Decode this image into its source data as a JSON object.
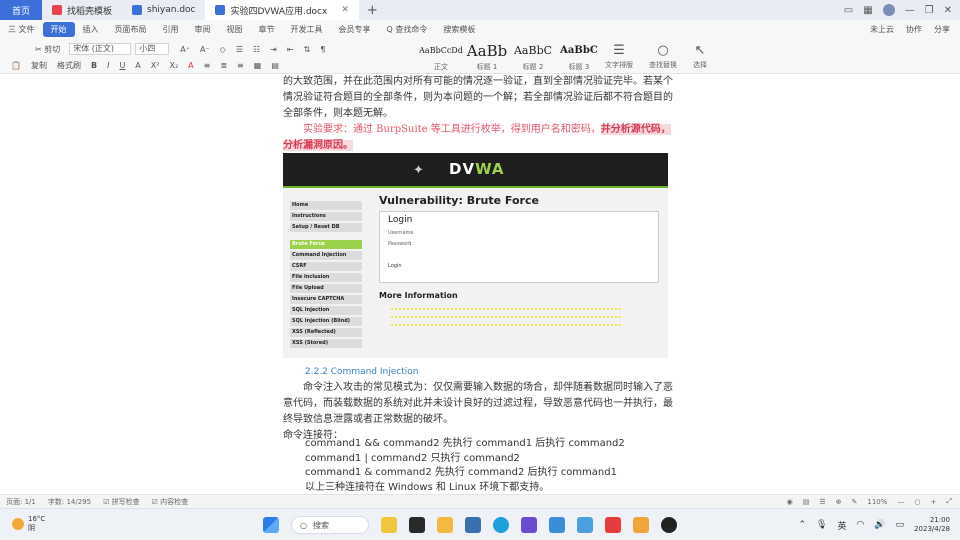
{
  "titlebar": {
    "tabs": [
      {
        "label": "首页",
        "color": "#3c6fd8"
      },
      {
        "label": "找稻壳模板",
        "color": "#e8424f"
      },
      {
        "label": "shiyan.doc",
        "color": "#3c6fd8"
      },
      {
        "label": "实验四DVWA应用.docx",
        "color": "#3c6fd8"
      }
    ],
    "plus": "+"
  },
  "menubar": {
    "items": [
      "三 文件",
      "开始",
      "插入",
      "页面布局",
      "引用",
      "审阅",
      "视图",
      "章节",
      "开发工具",
      "会员专享",
      "Q 查找命令",
      "搜索模板"
    ],
    "right": [
      "未上云",
      "协作",
      "分享"
    ]
  },
  "ribbon": {
    "row1": [
      "剪切",
      "宋体 (正文)",
      "小四",
      "A⁺",
      "A⁻"
    ],
    "row2": [
      "复制",
      "格式刷",
      "B",
      "I",
      "U",
      "A",
      "X²",
      "X₂",
      "A"
    ],
    "font": "宋体 (正文)",
    "size": "小四",
    "styles": [
      {
        "sample": "AaBbCcDd",
        "label": "正文"
      },
      {
        "sample": "AaBb",
        "label": "标题 1"
      },
      {
        "sample": "AaBbC",
        "label": "标题 2"
      },
      {
        "sample": "AaBbC",
        "label": "标题 3"
      }
    ],
    "tools": [
      {
        "label": "文字排版"
      },
      {
        "label": "查找替换"
      },
      {
        "label": "选择"
      }
    ]
  },
  "doc": {
    "para1": "的大致范围，并在此范围内对所有可能的情况逐一验证，直到全部情况验证完毕。若某个情况验证符合题目的全部条件，则为本问题的一个解；若全部情况验证后都不符合题目的全部条件，则本题无解。",
    "req_prefix": "实验要求：通过 BurpSuite 等工具进行枚举，得到用户名和密码，",
    "req_highlight": "并分析源代码，分析漏洞原因。",
    "dvwa": {
      "logo_a": "DV",
      "logo_b": "WA",
      "nav": [
        "Home",
        "Instructions",
        "Setup / Reset DB",
        "Brute Force",
        "Command Injection",
        "CSRF",
        "File Inclusion",
        "File Upload",
        "Insecure CAPTCHA",
        "SQL Injection",
        "SQL Injection (Blind)",
        "XSS (Reflected)",
        "XSS (Stored)"
      ],
      "title": "Vulnerability: Brute Force",
      "login_title": "Login",
      "username_label": "Username",
      "password_label": "Password",
      "login_button": "Login",
      "more_info": "More Information"
    },
    "heading2": "2.2.2 Command Injection",
    "para2": "命令注入攻击的常见模式为：仅仅需要输入数据的场合，却伴随着数据同时输入了恶意代码，而装载数据的系统对此并未设计良好的过滤过程，导致恶意代码也一并执行，最终导致信息泄露或者正常数据的破坏。",
    "para3": "命令连接符：",
    "cmds": [
      "command1 && command2  先执行 command1 后执行 command2",
      "command1 | command2  只执行 command2",
      "command1 & command2  先执行 command2 后执行 command1",
      "以上三种连接符在 Windows 和 Linux 环境下都支持。"
    ]
  },
  "statusbar": {
    "page": "页面: 1/1",
    "words": "字数: 14/295",
    "spell": "拼写检查",
    "content": "内容检查",
    "zoom": "110%"
  },
  "taskbar": {
    "temp": "16°C",
    "weather": "阴",
    "search": "搜索",
    "ime": "英",
    "time": "21:00",
    "date": "2023/4/28"
  }
}
